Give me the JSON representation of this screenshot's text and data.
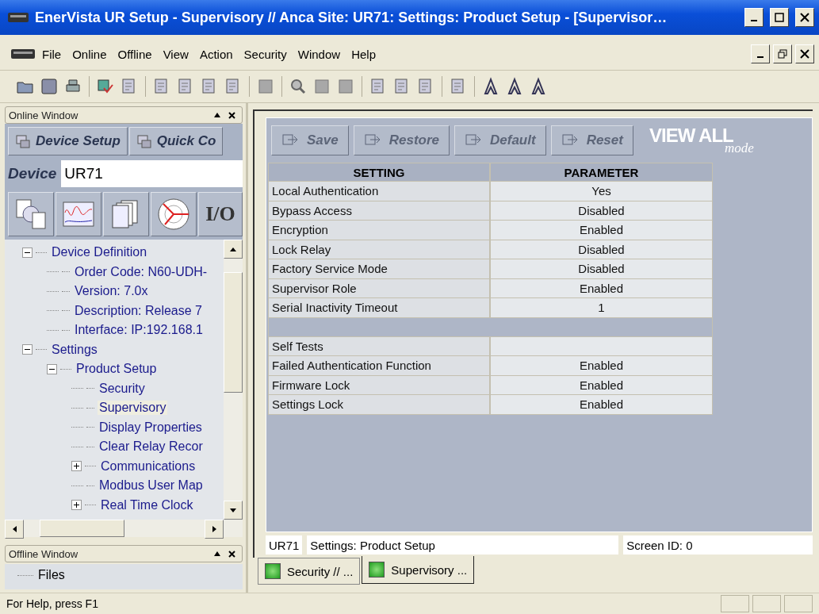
{
  "window": {
    "title": "EnerVista UR Setup  - Supervisory // Anca Site: UR71: Settings: Product Setup - [Supervisor…"
  },
  "menu": [
    {
      "label": "File"
    },
    {
      "label": "Online"
    },
    {
      "label": "Offline"
    },
    {
      "label": "View"
    },
    {
      "label": "Action"
    },
    {
      "label": "Security"
    },
    {
      "label": "Window"
    },
    {
      "label": "Help"
    }
  ],
  "online_window": {
    "title": "Online Window",
    "buttons": [
      "Device Setup",
      "Quick Co"
    ],
    "device_label": "Device",
    "device_value": "UR71",
    "io_label": "I/O",
    "tree": [
      {
        "label": "Device Definition",
        "expanded": true,
        "selected": false,
        "children": [
          {
            "label": "Order Code: N60-UDH-",
            "selected": false
          },
          {
            "label": "Version: 7.0x",
            "selected": false
          },
          {
            "label": "Description: Release 7",
            "selected": false
          },
          {
            "label": "Interface:  IP:192.168.1",
            "selected": false
          }
        ]
      },
      {
        "label": "Settings",
        "expanded": true,
        "selected": false,
        "children": [
          {
            "label": "Product Setup",
            "expanded": true,
            "selected": false,
            "children": [
              {
                "label": "Security",
                "selected": false
              },
              {
                "label": "Supervisory",
                "selected": true
              },
              {
                "label": "Display Properties",
                "selected": false
              },
              {
                "label": "Clear Relay Recor",
                "selected": false
              },
              {
                "label": "Communications",
                "expanded": false,
                "selected": false
              },
              {
                "label": "Modbus User Map",
                "selected": false
              },
              {
                "label": "Real Time Clock",
                "expanded": false,
                "selected": false
              }
            ]
          }
        ]
      }
    ]
  },
  "offline_window": {
    "title": "Offline Window",
    "tree": [
      {
        "label": "Files",
        "selected": false
      }
    ]
  },
  "settings_panel": {
    "actions": [
      {
        "label": "Save",
        "disabled": true
      },
      {
        "label": "Restore",
        "disabled": true
      },
      {
        "label": "Default",
        "disabled": true
      },
      {
        "label": "Reset",
        "disabled": true
      }
    ],
    "mode_logo": {
      "main": "VIEW ALL",
      "sub": "mode"
    },
    "table": {
      "columns": [
        "SETTING",
        "PARAMETER"
      ],
      "rows": [
        {
          "kind": "row",
          "setting": "Local Authentication",
          "parameter": "Yes"
        },
        {
          "kind": "row",
          "setting": "Bypass Access",
          "parameter": "Disabled"
        },
        {
          "kind": "row",
          "setting": "Encryption",
          "parameter": "Enabled"
        },
        {
          "kind": "row",
          "setting": "Lock Relay",
          "parameter": "Disabled"
        },
        {
          "kind": "row",
          "setting": "Factory Service Mode",
          "parameter": "Disabled"
        },
        {
          "kind": "row",
          "setting": "Supervisor Role",
          "parameter": "Enabled"
        },
        {
          "kind": "row",
          "setting": "Serial Inactivity Timeout",
          "parameter": "1"
        },
        {
          "kind": "separator"
        },
        {
          "kind": "row",
          "setting": "Self Tests"
        },
        {
          "kind": "row",
          "setting": "Failed Authentication Function",
          "parameter": "Enabled"
        },
        {
          "kind": "row",
          "setting": "Firmware Lock",
          "parameter": "Enabled"
        },
        {
          "kind": "row",
          "setting": "Settings Lock",
          "parameter": "Enabled"
        }
      ]
    },
    "status": [
      "UR71",
      "Settings: Product Setup",
      "Screen ID: 0"
    ]
  },
  "document_tabs": [
    {
      "label": "Security // ...",
      "selected": false
    },
    {
      "label": "Supervisory ...",
      "selected": true
    }
  ],
  "status_bar": {
    "text": "For Help, press F1"
  }
}
